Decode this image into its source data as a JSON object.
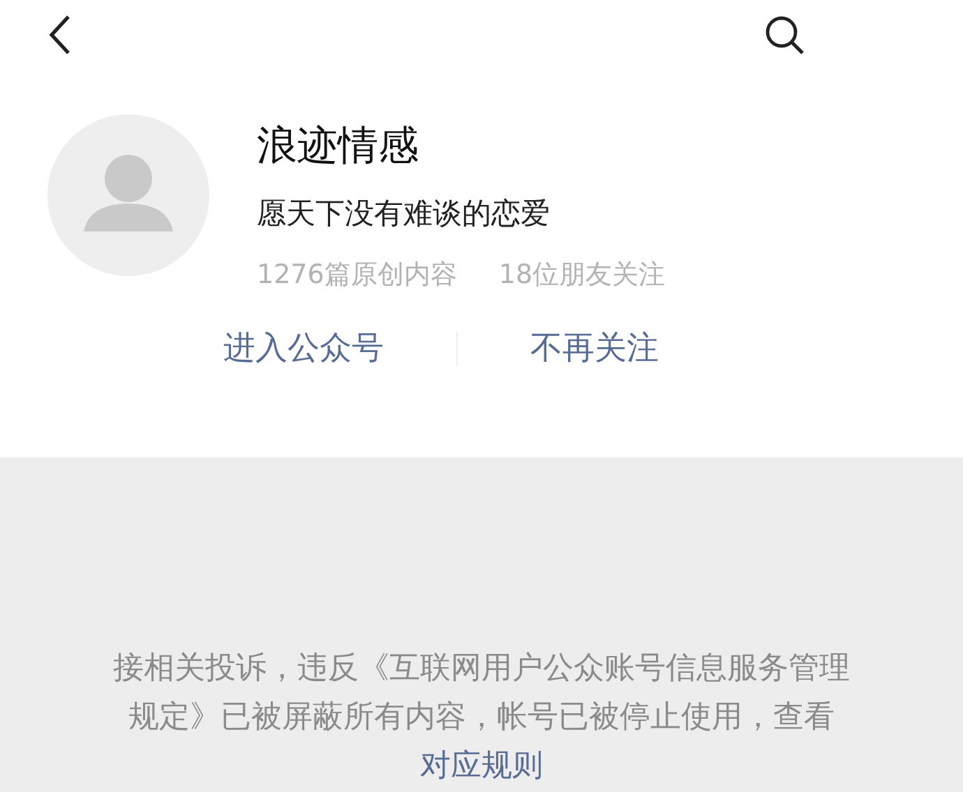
{
  "account": {
    "name": "浪迹情感",
    "motto": "愿天下没有难谈的恋爱",
    "stats": [
      "1276篇原创内容",
      "18位朋友关注"
    ]
  },
  "actions": [
    "进入公众号",
    "不再关注"
  ],
  "notice": {
    "text": "接相关投诉，违反《互联网用户公众账号信息服务管理规定》已被屏蔽所有内容，帐号已被停止使用，查看",
    "link": "对应规则"
  }
}
